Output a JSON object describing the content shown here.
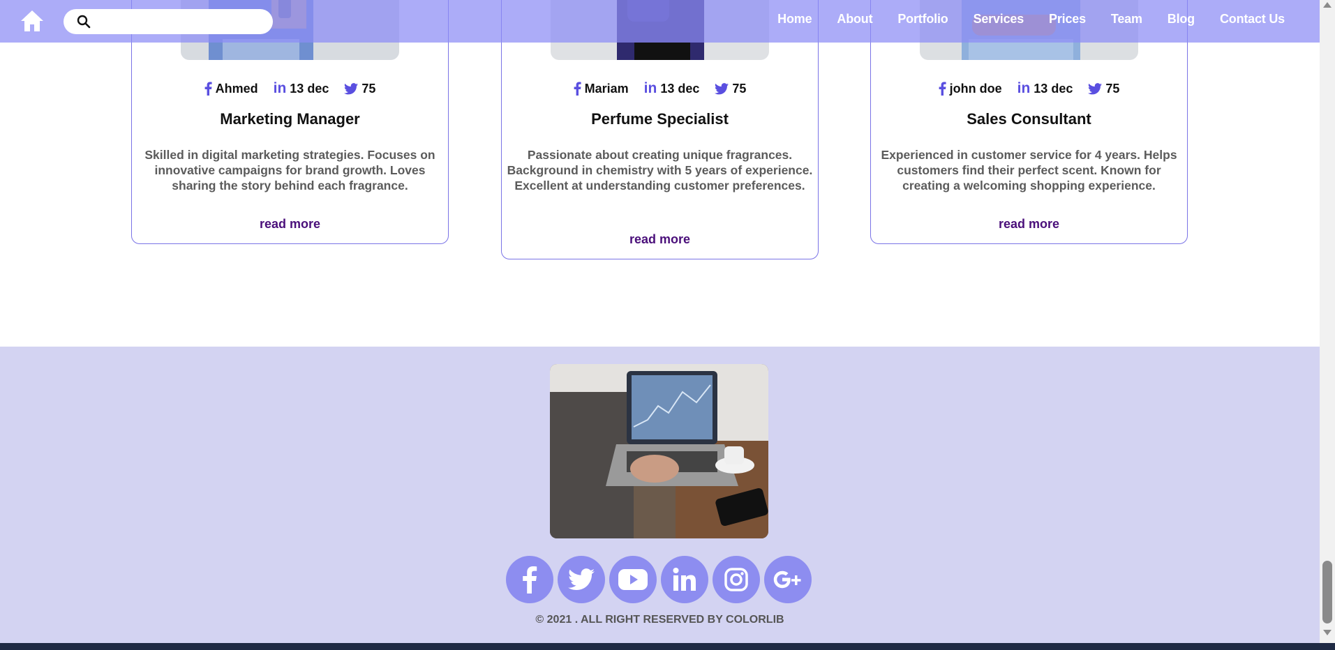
{
  "nav": {
    "search_placeholder": "",
    "links": [
      "Home",
      "About",
      "Portfolio",
      "Services",
      "Prices",
      "Team",
      "Blog",
      "Contact Us"
    ]
  },
  "team": [
    {
      "author": "Ahmed",
      "date": "13 dec",
      "count": "75",
      "title": "Marketing Manager",
      "description": "Skilled in digital marketing strategies. Focuses on innovative campaigns for brand growth. Loves sharing the story behind each fragrance.",
      "link": "read more"
    },
    {
      "author": "Mariam",
      "date": "13 dec",
      "count": "75",
      "title": "Perfume Specialist",
      "description": "Passionate about creating unique fragrances. Background in chemistry with 5 years of experience. Excellent at understanding customer preferences.",
      "link": "read more"
    },
    {
      "author": "john doe",
      "date": "13 dec",
      "count": "75",
      "title": "Sales Consultant",
      "description": "Experienced in customer service for 4 years. Helps customers find their perfect scent. Known for creating a welcoming shopping experience.",
      "link": "read more"
    }
  ],
  "footer": {
    "social_icons": [
      "facebook-icon",
      "twitter-icon",
      "youtube-icon",
      "linkedin-icon",
      "instagram-icon",
      "google-plus-icon"
    ],
    "copyright": "© 2021 . ALL RIGHT RESERVED BY COLORLIB"
  },
  "colors": {
    "nav_bg": "#8c8cf5",
    "accent": "#5a4fe0",
    "footer_bg": "#d3d3f2",
    "social_bg": "#8d8df0",
    "link": "#4a0f7a"
  }
}
